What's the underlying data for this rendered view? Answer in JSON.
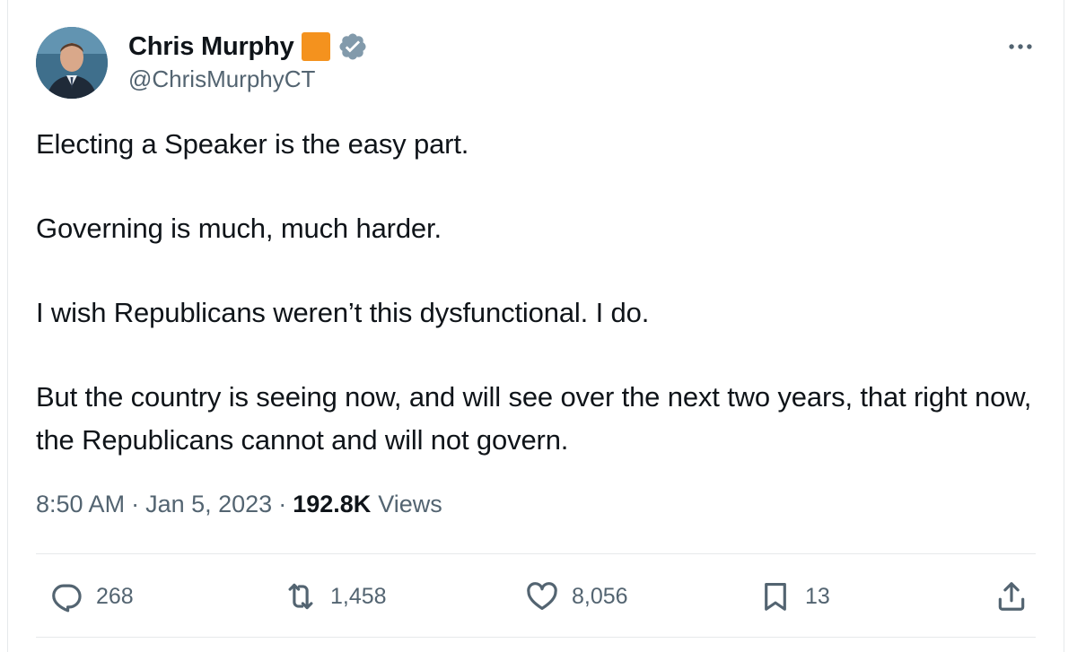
{
  "author": {
    "name": "Chris Murphy",
    "handle": "@ChrisMurphyCT",
    "affiliate_badge_color": "#f4921e",
    "verified_badge_color": "#829aab"
  },
  "tweet": {
    "paragraphs": [
      "Electing a Speaker is the easy part.",
      "Governing is much, much harder.",
      "I wish Republicans weren’t this dysfunctional. I do.",
      "But the country is seeing now, and will see over the next two years, that right now, the Republicans cannot and will not govern."
    ],
    "time": "8:50 AM",
    "separator": "·",
    "date": "Jan 5, 2023",
    "views_count": "192.8K",
    "views_label": "Views"
  },
  "actions": {
    "replies": "268",
    "reposts": "1,458",
    "likes": "8,056",
    "bookmarks": "13"
  },
  "icons": {
    "more": "more-horizontal-icon",
    "reply": "reply-icon",
    "repost": "repost-icon",
    "like": "heart-icon",
    "bookmark": "bookmark-icon",
    "share": "share-icon"
  },
  "colors": {
    "text": "#0f1419",
    "secondary": "#536471",
    "divider": "#e6e9eb"
  }
}
